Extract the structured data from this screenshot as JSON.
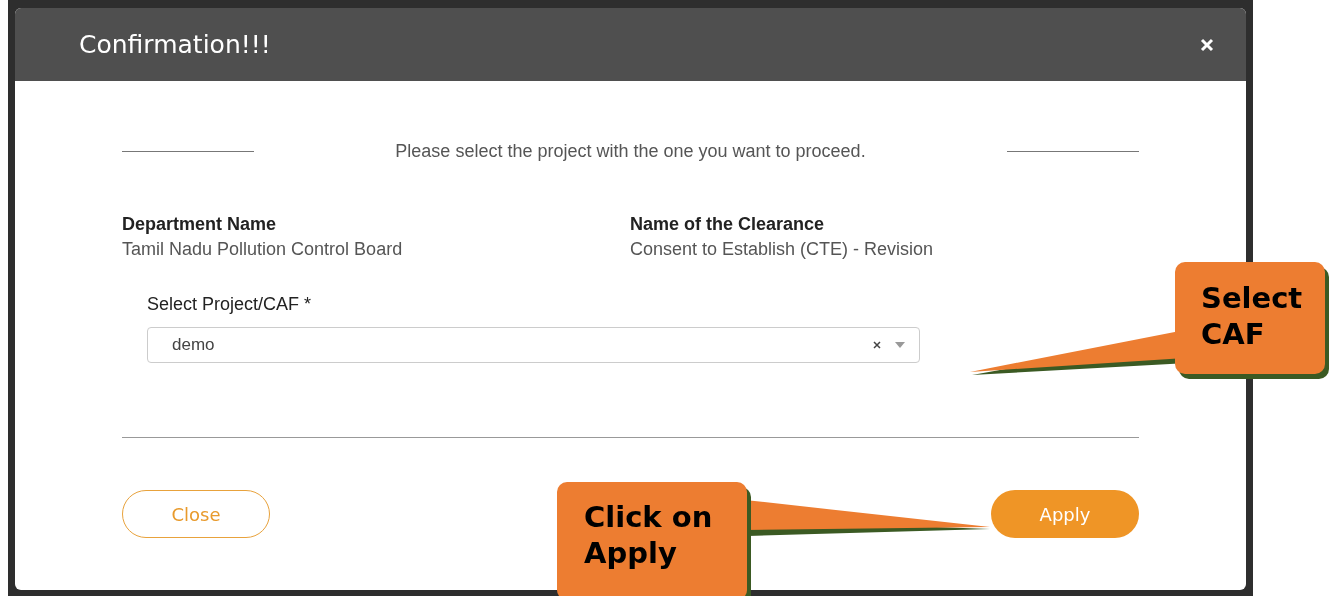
{
  "modal": {
    "title": "Confirmation!!!"
  },
  "intro": "Please select the project with the one you want to proceed.",
  "details": [
    {
      "label": "Department Name",
      "value": "Tamil Nadu Pollution Control Board"
    },
    {
      "label": "Name of the Clearance",
      "value": "Consent to Establish (CTE) - Revision"
    }
  ],
  "project_select": {
    "label": "Select Project/CAF *",
    "value": "demo"
  },
  "buttons": [
    {
      "label": "Close",
      "kind": "outline"
    },
    {
      "label": "Apply",
      "kind": "primary"
    }
  ],
  "callouts": [
    {
      "text": "Select CAF",
      "kind": "select"
    },
    {
      "text": "Click on Apply",
      "kind": "apply"
    }
  ]
}
